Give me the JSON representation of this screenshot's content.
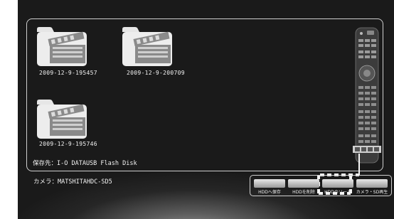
{
  "files": [
    {
      "name": "2009-12-9-195457"
    },
    {
      "name": "2009-12-9-200709"
    },
    {
      "name": "2009-12-9-195746"
    }
  ],
  "storage": {
    "text": "保存先：I-O DATAUSB Flash Disk"
  },
  "camera": {
    "text": "カメラ：MATSHITAHDC-SD5"
  },
  "buttons": [
    {
      "label": "HDDへ保存"
    },
    {
      "label": "HDDを削除"
    },
    {
      "label": "HDDのソート"
    },
    {
      "label": "カメラ・SD再生"
    }
  ],
  "colors": {
    "background": "#1b1b1b",
    "text": "#f2f2f2",
    "button": "#c8c8c8"
  },
  "icons": [
    "folder-video-icon",
    "remote-control-icon"
  ]
}
